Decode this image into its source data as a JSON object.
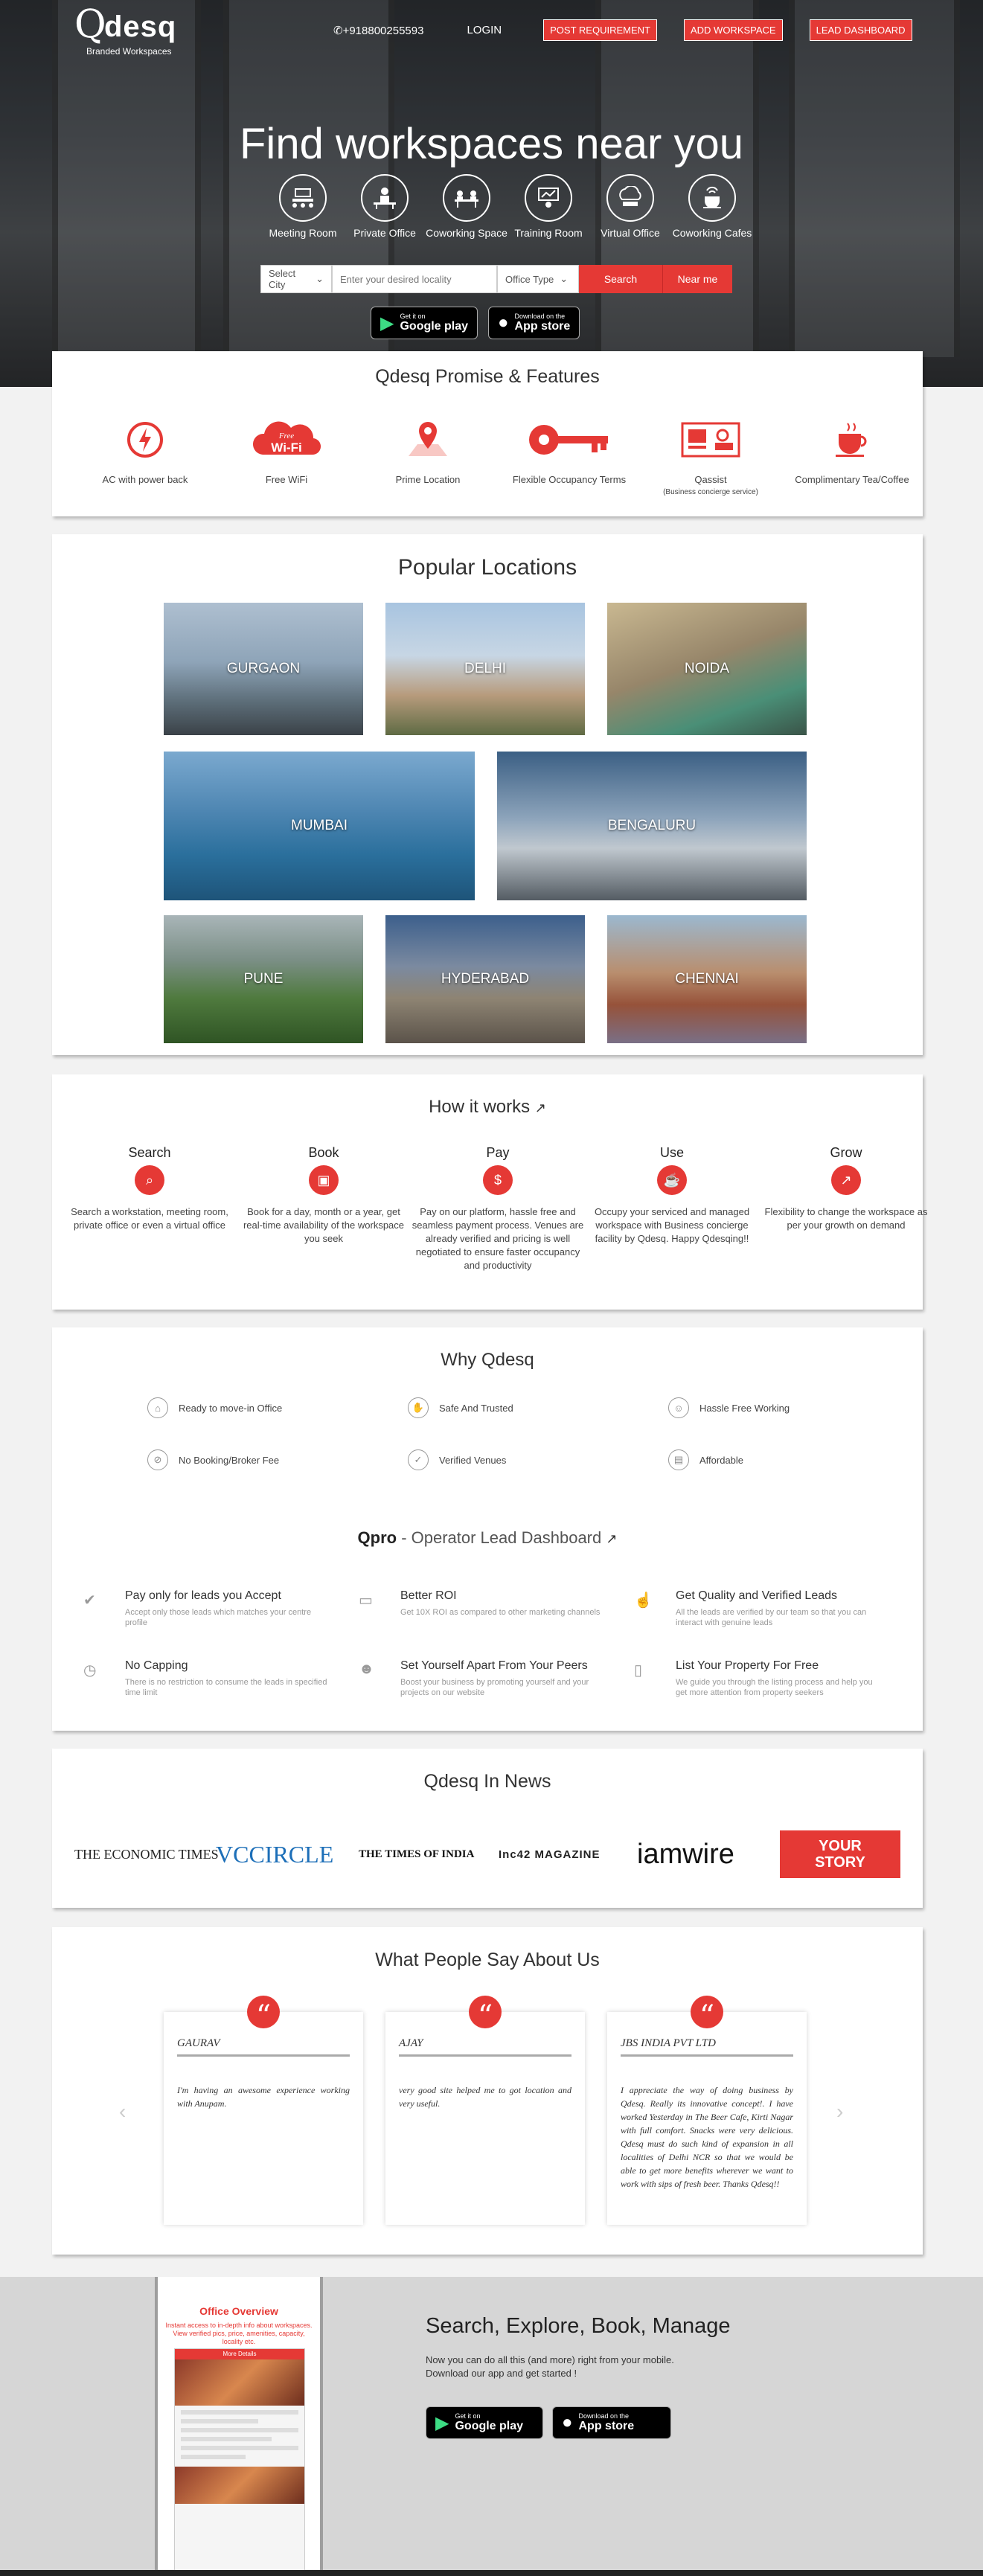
{
  "header": {
    "logo_mark": "Q",
    "logo_name": "desq",
    "logo_tagline": "Branded Workspaces",
    "phone": "+918800255593",
    "login": "LOGIN",
    "post_requirement": "POST REQUIREMENT",
    "add_workspace": "ADD WORKSPACE",
    "lead_dashboard": "LEAD DASHBOARD"
  },
  "hero": {
    "title": "Find workspaces near you",
    "categories": [
      {
        "label": "Meeting Room",
        "icon": "meeting-room-icon"
      },
      {
        "label": "Private Office",
        "icon": "private-office-icon"
      },
      {
        "label": "Coworking Space",
        "icon": "coworking-space-icon"
      },
      {
        "label": "Training Room",
        "icon": "training-room-icon"
      },
      {
        "label": "Virtual Office",
        "icon": "virtual-office-icon"
      },
      {
        "label": "Coworking Cafes",
        "icon": "coworking-cafe-icon"
      }
    ],
    "search": {
      "city_select": "Select City",
      "locality_placeholder": "Enter your desired locality",
      "office_type": "Office Type",
      "search_button": "Search",
      "near_me_button": "Near me"
    },
    "apps": {
      "google_small": "Get it on",
      "google_big": "Google play",
      "apple_small": "Download on the",
      "apple_big": "App store"
    }
  },
  "features": {
    "title": "Qdesq Promise & Features",
    "items": [
      {
        "label": "AC with power back",
        "icon": "ac-power-icon"
      },
      {
        "label": "Free WiFi",
        "icon": "wifi-cloud-icon",
        "badge_small": "Free",
        "badge_big": "Wi-Fi"
      },
      {
        "label": "Prime Location",
        "icon": "location-pin-icon"
      },
      {
        "label": "Flexible Occupancy Terms",
        "icon": "key-icon"
      },
      {
        "label": "Qassist",
        "sub": "(Business concierge service)",
        "icon": "concierge-icon"
      },
      {
        "label": "Complimentary Tea/Coffee",
        "icon": "coffee-cup-icon"
      }
    ]
  },
  "locations": {
    "title": "Popular Locations",
    "cities": [
      "GURGAON",
      "DELHI",
      "NOIDA",
      "MUMBAI",
      "BENGALURU",
      "PUNE",
      "HYDERABAD",
      "CHENNAI"
    ]
  },
  "how_it_works": {
    "title": "How it works",
    "steps": [
      {
        "title": "Search",
        "text": "Search a workstation, meeting room, private office or even a virtual office"
      },
      {
        "title": "Book",
        "text": "Book for a day, month or a year, get real-time availability of the workspace you seek"
      },
      {
        "title": "Pay",
        "text": "Pay on our platform, hassle free and seamless payment process. Venues are already verified and pricing is well negotiated to ensure faster occupancy and productivity"
      },
      {
        "title": "Use",
        "text": "Occupy your serviced and managed workspace with Business concierge facility by Qdesq. Happy Qdesqing!!"
      },
      {
        "title": "Grow",
        "text": "Flexibility to change the workspace as per your growth on demand"
      }
    ]
  },
  "why": {
    "title": "Why Qdesq",
    "items": [
      "Ready to move-in Office",
      "Safe And Trusted",
      "Hassle Free Working",
      "No Booking/Broker Fee",
      "Verified Venues",
      "Affordable"
    ],
    "qpro_bold": "Qpro",
    "qpro_rest": " - Operator Lead Dashboard",
    "qpro_items": [
      {
        "title": "Pay only for leads you Accept",
        "text": "Accept only those leads which matches your centre profile",
        "icon": "check-icon"
      },
      {
        "title": "Better ROI",
        "text": "Get 10X ROI as compared to other marketing channels",
        "icon": "credit-card-icon"
      },
      {
        "title": "Get Quality and Verified Leads",
        "text": "All the leads are verified by our team so that you can interact with genuine leads",
        "icon": "thumbs-up-icon"
      },
      {
        "title": "No Capping",
        "text": "There is no restriction to consume the leads in specified time limit",
        "icon": "clock-icon"
      },
      {
        "title": "Set Yourself Apart From Your Peers",
        "text": "Boost your business by promoting yourself and your projects on our website",
        "icon": "users-icon"
      },
      {
        "title": "List Your Property For Free",
        "text": "We guide you through the listing process and help you get more attention from property seekers",
        "icon": "document-icon"
      }
    ]
  },
  "news": {
    "title": "Qdesq In News",
    "logos": [
      "THE ECONOMIC TIMES",
      "VCCIRCLE",
      "THE TIMES OF INDIA",
      "Inc42 MAGAZINE",
      "iamwire",
      "YOUR STORY"
    ]
  },
  "testimonials": {
    "title": "What People Say About Us",
    "items": [
      {
        "name": "GAURAV",
        "text": "I'm having an awesome experience working with Anupam."
      },
      {
        "name": "AJAY",
        "text": "very good site helped me to got location and very useful."
      },
      {
        "name": "JBS INDIA PVT LTD",
        "text": "I appreciate the way of doing business by Qdesq. Really its innovative concept!. I have worked Yesterday in The Beer Cafe, Kirti Nagar with full comfort. Snacks were very delicious. Qdesq must do such kind of expansion in all localities of Delhi NCR so that we would be able to get more benefits wherever we want to work with sips of fresh beer. Thanks Qdesq!!"
      }
    ]
  },
  "app_section": {
    "title": "Search, Explore, Book, Manage",
    "line1": "Now you can do all this (and more) right from your mobile.",
    "line2": "Download our app and get started !",
    "mock_title": "Office Overview",
    "mock_sub": "Instant access to in-depth info about workspaces. View verified pics, price, amenities, capacity, locality etc.",
    "mock_header": "More Details"
  }
}
